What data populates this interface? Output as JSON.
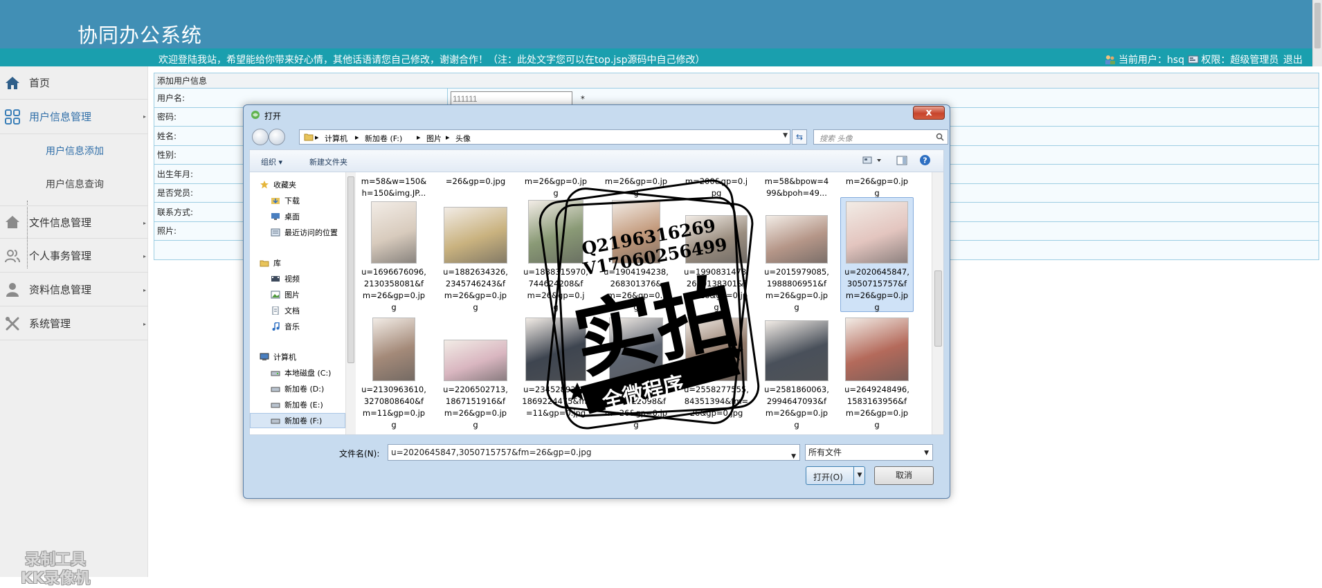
{
  "header": {
    "title": "协同办公系统",
    "welcome": "欢迎登陆我站，希望能给你带来好心情，其他话语请您自己修改，谢谢合作！（注：此处文字您可以在top.jsp源码中自己修改）",
    "current_user_label": "当前用户：hsq",
    "permission_label": "权限：超级管理员",
    "logout": "退出"
  },
  "sidebar": {
    "items": [
      {
        "label": "首页",
        "icon": "home-icon"
      },
      {
        "label": "用户信息管理",
        "icon": "grid-icon"
      },
      {
        "label": "文件信息管理",
        "icon": "house-icon"
      },
      {
        "label": "个人事务管理",
        "icon": "people-icon"
      },
      {
        "label": "资料信息管理",
        "icon": "person-icon"
      },
      {
        "label": "系统管理",
        "icon": "tools-icon"
      }
    ],
    "sub_items": [
      {
        "label": "用户信息添加"
      },
      {
        "label": "用户信息查询"
      }
    ],
    "watermark": [
      "录制工具",
      "KK录像机"
    ]
  },
  "form": {
    "title": "添加用户信息",
    "rows": [
      {
        "label": "用户名:",
        "value": "111111",
        "required": "*"
      },
      {
        "label": "密码:"
      },
      {
        "label": "姓名:"
      },
      {
        "label": "性别:"
      },
      {
        "label": "出生年月:"
      },
      {
        "label": "是否党员:"
      },
      {
        "label": "联系方式:"
      },
      {
        "label": "照片:"
      }
    ]
  },
  "dialog": {
    "title": "打开",
    "close": "x",
    "breadcrumb": [
      "计算机",
      "新加卷 (F:)",
      "图片",
      "头像"
    ],
    "search_placeholder": "搜索 头像",
    "toolbar": {
      "organize": "组织 ▾",
      "new_folder": "新建文件夹"
    },
    "nav_pane": [
      {
        "label": "收藏夹",
        "icon": "star-icon"
      },
      {
        "label": "下载",
        "icon": "download-folder-icon"
      },
      {
        "label": "桌面",
        "icon": "desktop-icon"
      },
      {
        "label": "最近访问的位置",
        "icon": "recent-icon"
      },
      {
        "label": "库",
        "icon": "library-icon"
      },
      {
        "label": "视频",
        "icon": "video-icon"
      },
      {
        "label": "图片",
        "icon": "pictures-icon"
      },
      {
        "label": "文档",
        "icon": "documents-icon"
      },
      {
        "label": "音乐",
        "icon": "music-icon"
      },
      {
        "label": "计算机",
        "icon": "computer-icon"
      },
      {
        "label": "本地磁盘 (C:)",
        "icon": "drive-icon"
      },
      {
        "label": "新加卷 (D:)",
        "icon": "drive-icon"
      },
      {
        "label": "新加卷 (E:)",
        "icon": "drive-icon"
      },
      {
        "label": "新加卷 (F:)",
        "icon": "drive-icon"
      }
    ],
    "files_row0": [
      {
        "name": "m=58&w=150&\nh=150&img.JP..."
      },
      {
        "name": "=26&gp=0.jpg"
      },
      {
        "name": "m=26&gp=0.jp\ng"
      },
      {
        "name": "m=26&gp=0.jp\ng"
      },
      {
        "name": "m=200&gp=0.j\npg"
      },
      {
        "name": "m=58&bpow=4\n99&bpoh=49..."
      },
      {
        "name": "m=26&gp=0.jp\ng"
      }
    ],
    "files_row1": [
      {
        "name": "u=1696676096,\n2130358081&f\nm=26&gp=0.jp\ng",
        "color": "#d8cbbd"
      },
      {
        "name": "u=1882634326,\n2345746243&f\nm=26&gp=0.jp\ng",
        "color": "#c9b27f"
      },
      {
        "name": "u=1888315970,\n744624208&f\nm=26&gp=0.j\ng",
        "color": "#8a9a76"
      },
      {
        "name": "u=1904194238,\n268301376&\nm=26&gp=0.j\ng",
        "color": "#c39a7c"
      },
      {
        "name": "u=1990831478,\n2620138301&f\nm=26&gp=0.jp\ng",
        "color": "#9a8d7f"
      },
      {
        "name": "u=2015979085,\n1988806951&f\nm=26&gp=0.jp\ng",
        "color": "#b59688"
      },
      {
        "name": "u=2020645847,\n3050715757&f\nm=26&gp=0.jp\ng",
        "color": "#e3c5bf"
      }
    ],
    "files_row2": [
      {
        "name": "u=2130963610,\n3270808640&f\nm=11&gp=0.jp\ng",
        "color": "#a48a79"
      },
      {
        "name": "u=2206502713,\n1867151916&f\nm=26&gp=0.jp\ng",
        "color": "#d9b6c0"
      },
      {
        "name": "u=2345289381,\n1869224475&fm\n=11&gp=0.jpg",
        "color": "#3e4550"
      },
      {
        "name": "u=2446649186,\n3642422098&f\nm=26&gp=0.jp\ng",
        "color": "#5d6470"
      },
      {
        "name": "u=2558277555,\n84351394&fm=\n26&gp=0.jpg",
        "color": "#8f7767"
      },
      {
        "name": "u=2581860063,\n2994647093&f\nm=26&gp=0.jp\ng",
        "color": "#49505a"
      },
      {
        "name": "u=2649248496,\n1583163956&f\nm=26&gp=0.jp\ng",
        "color": "#b46a5b"
      }
    ],
    "filename_label": "文件名(N):",
    "filename_value": "u=2020645847,3050715757&fm=26&gp=0.jpg",
    "filetype_value": "所有文件",
    "open_label": "打开(O)",
    "cancel_label": "取消"
  },
  "stamp": {
    "line1": "Q2196316269",
    "line2": "V17060256499",
    "main": "实拍",
    "ribbon": "全微程序"
  }
}
